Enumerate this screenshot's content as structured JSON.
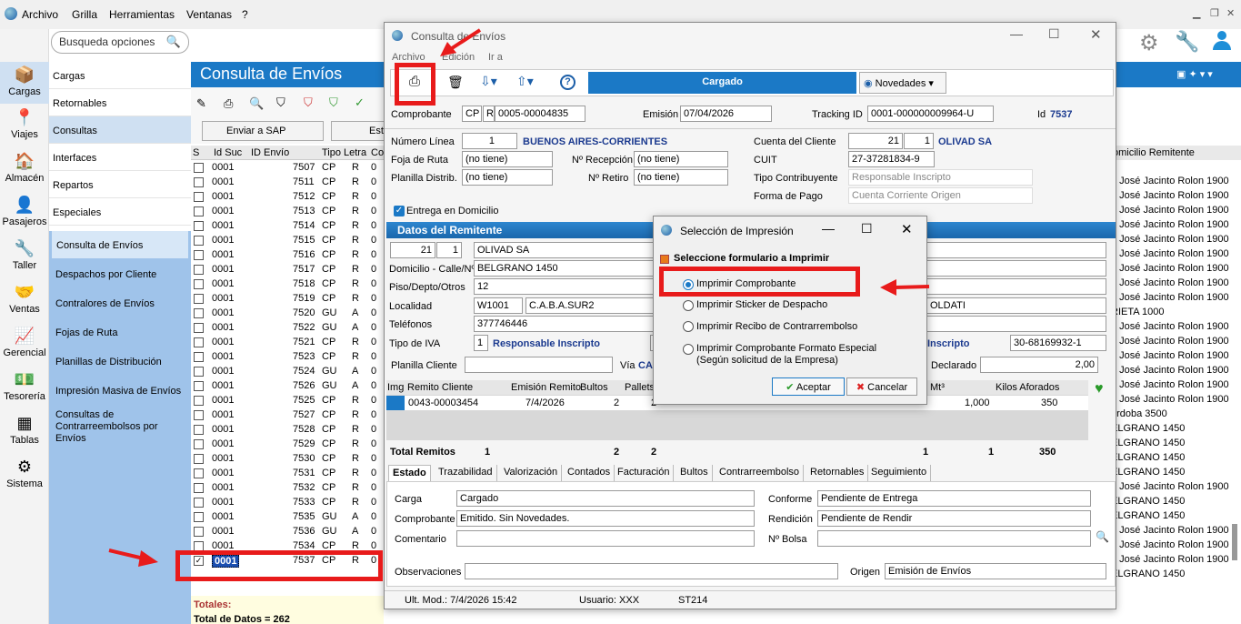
{
  "menubar": {
    "items": [
      "Archivo",
      "Grilla",
      "Herramientas",
      "Ventanas",
      "?"
    ]
  },
  "iconbar": {
    "items": [
      {
        "label": "Cargas",
        "icon": "box-icon",
        "glyph": "📦"
      },
      {
        "label": "Viajes",
        "icon": "map-pin-icon",
        "glyph": "📍"
      },
      {
        "label": "Almacén",
        "icon": "warehouse-icon",
        "glyph": "🏠"
      },
      {
        "label": "Pasajeros",
        "icon": "passenger-icon",
        "glyph": "👤"
      },
      {
        "label": "Taller",
        "icon": "wrench-icon",
        "glyph": "🔧"
      },
      {
        "label": "Ventas",
        "icon": "sales-icon",
        "glyph": "🤝"
      },
      {
        "label": "Gerencial",
        "icon": "chart-icon",
        "glyph": "📈"
      },
      {
        "label": "Tesorería",
        "icon": "money-icon",
        "glyph": "💵"
      },
      {
        "label": "Tablas",
        "icon": "table-icon",
        "glyph": "▦"
      },
      {
        "label": "Sistema",
        "icon": "gear-icon",
        "glyph": "⚙"
      }
    ]
  },
  "search": {
    "placeholder": "Busqueda opciones"
  },
  "nav": {
    "main": [
      "Cargas",
      "Retornables",
      "Consultas",
      "Interfaces",
      "Repartos",
      "Especiales"
    ],
    "sub": [
      "Consulta de Envíos",
      "Despachos por Cliente",
      "Contralores de Envíos",
      "Fojas de Ruta",
      "Planillas de Distribución",
      "Impresión Masiva de Envíos",
      "Consultas de Contrarreembolsos por Envíos"
    ]
  },
  "bg": {
    "title": "Consulta de Envíos",
    "send_sap": "Enviar a SAP",
    "est": "Est",
    "columns": [
      "S",
      "Id Suc",
      "ID Envío",
      "Tipo",
      "Letra",
      "Co"
    ],
    "rows": [
      [
        "0001",
        "7507",
        "CP",
        "R"
      ],
      [
        "0001",
        "7511",
        "CP",
        "R"
      ],
      [
        "0001",
        "7512",
        "CP",
        "R"
      ],
      [
        "0001",
        "7513",
        "CP",
        "R"
      ],
      [
        "0001",
        "7514",
        "CP",
        "R"
      ],
      [
        "0001",
        "7515",
        "CP",
        "R"
      ],
      [
        "0001",
        "7516",
        "CP",
        "R"
      ],
      [
        "0001",
        "7517",
        "CP",
        "R"
      ],
      [
        "0001",
        "7518",
        "CP",
        "R"
      ],
      [
        "0001",
        "7519",
        "CP",
        "R"
      ],
      [
        "0001",
        "7520",
        "GU",
        "A"
      ],
      [
        "0001",
        "7522",
        "GU",
        "A"
      ],
      [
        "0001",
        "7521",
        "CP",
        "R"
      ],
      [
        "0001",
        "7523",
        "CP",
        "R"
      ],
      [
        "0001",
        "7524",
        "GU",
        "A"
      ],
      [
        "0001",
        "7526",
        "GU",
        "A"
      ],
      [
        "0001",
        "7525",
        "CP",
        "R"
      ],
      [
        "0001",
        "7527",
        "CP",
        "R"
      ],
      [
        "0001",
        "7528",
        "CP",
        "R"
      ],
      [
        "0001",
        "7529",
        "CP",
        "R"
      ],
      [
        "0001",
        "7530",
        "CP",
        "R"
      ],
      [
        "0001",
        "7531",
        "CP",
        "R"
      ],
      [
        "0001",
        "7532",
        "CP",
        "R"
      ],
      [
        "0001",
        "7533",
        "CP",
        "R"
      ],
      [
        "0001",
        "7535",
        "GU",
        "A"
      ],
      [
        "0001",
        "7536",
        "GU",
        "A"
      ],
      [
        "0001",
        "7534",
        "CP",
        "R"
      ],
      [
        "0001",
        "7537",
        "CP",
        "R"
      ]
    ],
    "right_header": "omicilio Remitente",
    "right_rows": [
      "r. José Jacinto Rolon 1900",
      "r. José Jacinto Rolon 1900",
      "r. José Jacinto Rolon 1900",
      "r. José Jacinto Rolon 1900",
      "r. José Jacinto Rolon 1900",
      "r. José Jacinto Rolon 1900",
      "r. José Jacinto Rolon 1900",
      "r. José Jacinto Rolon 1900",
      "r. José Jacinto Rolon 1900",
      "RIETA 1000",
      "r. José Jacinto Rolon 1900",
      "r. José Jacinto Rolon 1900",
      "r. José Jacinto Rolon 1900",
      "r. José Jacinto Rolon 1900",
      "r. José Jacinto Rolon 1900",
      "r. José Jacinto Rolon 1900",
      "órdoba 3500",
      "ELGRANO 1450",
      "ELGRANO 1450",
      "ELGRANO 1450",
      "ELGRANO 1450",
      "r. José Jacinto Rolon 1900",
      "ELGRANO 1450",
      "ELGRANO 1450",
      "r. José Jacinto Rolon 1900",
      "r. José Jacinto Rolon 1900",
      "r. José Jacinto Rolon 1900",
      "ELGRANO 1450"
    ],
    "totales": "Totales:",
    "total_datos": "Total de Datos = 262"
  },
  "dlg": {
    "title": "Consulta de Envíos",
    "menu": [
      "Archivo",
      "Edición",
      "Ir a"
    ],
    "cargado": "Cargado",
    "novedades": "Novedades",
    "comprobante_lbl": "Comprobante",
    "comp_tipo": "CP",
    "comp_letra": "R",
    "comp_num": "0005-00004835",
    "emision_lbl": "Emisión",
    "emision": "07/04/2026",
    "tracking_lbl": "Tracking ID",
    "tracking": "0001-000000009964-U",
    "id_lbl": "Id",
    "id": "7537",
    "numlinea_lbl": "Número Línea",
    "numlinea": "1",
    "linea": "BUENOS AIRES-CORRIENTES",
    "foja_lbl": "Foja de Ruta",
    "foja": "(no tiene)",
    "planilla_lbl": "Planilla Distrib.",
    "planilla": "(no tiene)",
    "nrecep_lbl": "Nº Recepción",
    "nrecep": "(no tiene)",
    "nretiro_lbl": "Nº Retiro",
    "nretiro": "(no tiene)",
    "cuenta_lbl": "Cuenta del Cliente",
    "cuenta1": "21",
    "cuenta2": "1",
    "cliente": "OLIVAD SA",
    "cuit_lbl": "CUIT",
    "cuit": "27-37281834-9",
    "tipocont_lbl": "Tipo Contribuyente",
    "tipocont": "Responsable Inscripto",
    "formapago_lbl": "Forma de Pago",
    "formapago": "Cuenta Corriente Origen",
    "entrega": "Entrega en Domicilio",
    "remitente_hdr": "Datos del Remitente",
    "rem1": "21",
    "rem2": "1",
    "rem_nombre": "OLIVAD SA",
    "dom_lbl": "Domicilio - Calle/Nº",
    "dom": "BELGRANO 1450",
    "piso_lbl": "Piso/Depto/Otros",
    "piso": "12",
    "loc_lbl": "Localidad",
    "loc_cp": "W1001",
    "loc": "C.A.B.A.SUR2",
    "tel_lbl": "Teléfonos",
    "tel": "377746446",
    "iva_lbl": "Tipo de IVA",
    "iva_num": "1",
    "iva": "Responsable Inscripto",
    "right_oldati": "OLDATI",
    "right_inscripto": "Inscripto",
    "right_cuit": "30-68169932-1",
    "planillacli_lbl": "Planilla Cliente",
    "via_lbl": "Vía",
    "via": "CA",
    "declarado_lbl": "Declarado",
    "declarado": "2,00",
    "remitos_cols": [
      "Img",
      "Remito Cliente",
      "Emisión Remito",
      "Bultos",
      "Pallets"
    ],
    "remitos_row": [
      "0043-00003454",
      "7/4/2026",
      "2",
      "2"
    ],
    "mt3_lbl": "Mt³",
    "kilos_lbl": "Kilos Aforados",
    "mt3": "1,000",
    "kilos": "350",
    "total_remitos_lbl": "Total Remitos",
    "tr1": "1",
    "tr2": "2",
    "tr3": "2",
    "tr4": "1",
    "tr5": "1",
    "tr6": "350",
    "tabs": [
      "Estado",
      "Trazabilidad",
      "Valorización",
      "Contados",
      "Facturación",
      "Bultos",
      "Contrarreembolso",
      "Retornables",
      "Seguimiento"
    ],
    "carga_lbl": "Carga",
    "carga": "Cargado",
    "comprobante2_lbl": "Comprobante",
    "comprobante2": "Emitido. Sin Novedades.",
    "comentario_lbl": "Comentario",
    "conforme_lbl": "Conforme",
    "conforme": "Pendiente de Entrega",
    "rendicion_lbl": "Rendición",
    "rendicion": "Pendiente de Rendir",
    "bolsa_lbl": "Nº Bolsa",
    "obs_lbl": "Observaciones",
    "origen_lbl": "Origen",
    "origen": "Emisión de Envíos",
    "status_mod": "Ult. Mod.: 7/4/2026 15:42",
    "status_user": "Usuario: XXX",
    "status_st": "ST214"
  },
  "pop": {
    "title": "Selección de Impresión",
    "header": "Seleccione formulario a Imprimir",
    "options": [
      "Imprimir Comprobante",
      "Imprimir Sticker de Despacho",
      "Imprimir Recibo de Contrarrembolso",
      "Imprimir Comprobante Formato Especial"
    ],
    "option4_sub": "(Según solicitud de la Empresa)",
    "ok": "Aceptar",
    "cancel": "Cancelar"
  },
  "colors": {
    "accent": "#1b79c6",
    "annotation": "#e81b1b",
    "nav_sub_bg": "#9fc3ea"
  }
}
